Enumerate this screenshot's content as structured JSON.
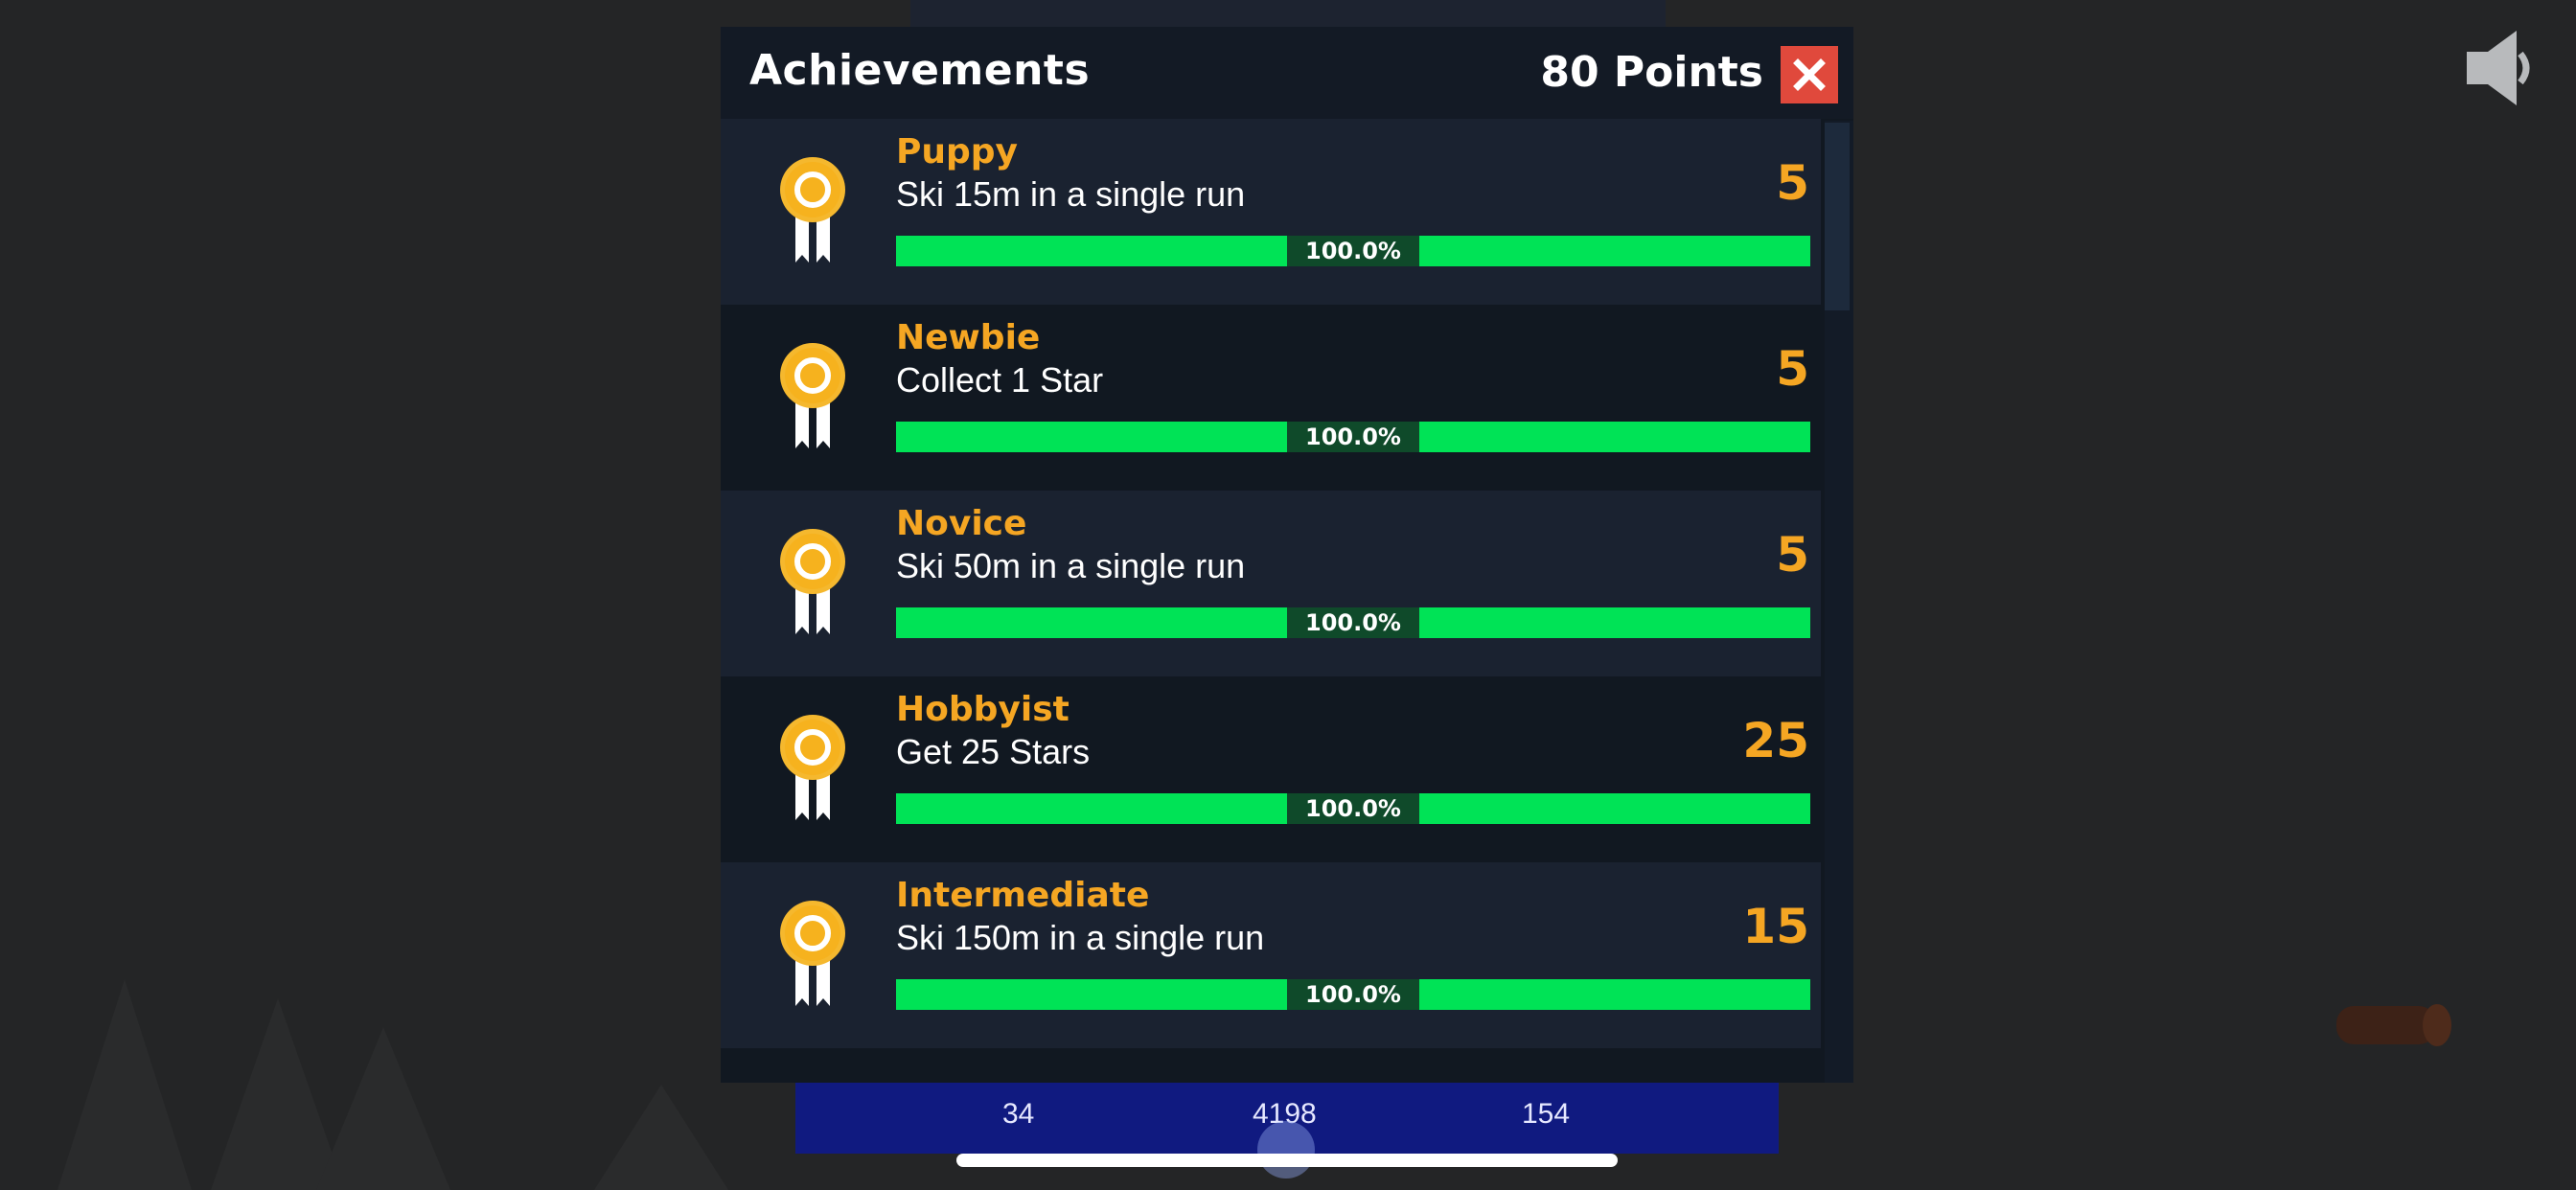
{
  "header": {
    "title": "Achievements",
    "points": "80 Points"
  },
  "close_button": {
    "label": "×",
    "icon": "close-icon"
  },
  "sound_button": {
    "icon": "speaker-icon"
  },
  "achievements": [
    {
      "name": "Puppy",
      "description": "Ski 15m in a single run",
      "points": "5",
      "progress_label": "100.0%",
      "progress": 1.0,
      "icon": "medal-icon"
    },
    {
      "name": "Newbie",
      "description": "Collect 1 Star",
      "points": "5",
      "progress_label": "100.0%",
      "progress": 1.0,
      "icon": "medal-icon"
    },
    {
      "name": "Novice",
      "description": "Ski 50m in a single run",
      "points": "5",
      "progress_label": "100.0%",
      "progress": 1.0,
      "icon": "medal-icon"
    },
    {
      "name": "Hobbyist",
      "description": "Get 25 Stars",
      "points": "25",
      "progress_label": "100.0%",
      "progress": 1.0,
      "icon": "medal-icon"
    },
    {
      "name": "Intermediate",
      "description": "Ski 150m in a single run",
      "points": "15",
      "progress_label": "100.0%",
      "progress": 1.0,
      "icon": "medal-icon"
    }
  ],
  "stats_bar": {
    "left": "34",
    "middle": "4198",
    "right": "154"
  },
  "colors": {
    "accent": "#f5a623",
    "progress": "#00e356",
    "close": "#e0493c",
    "stats_bar": "#101a80"
  }
}
